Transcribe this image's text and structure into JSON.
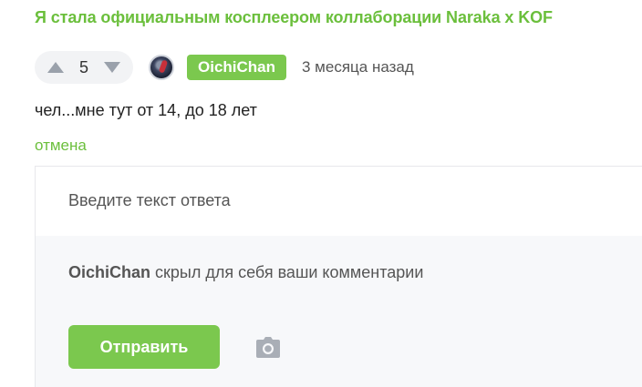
{
  "post": {
    "title": "Я стала официальным косплеером коллаборации Naraka x KOF"
  },
  "comment": {
    "votes": "5",
    "username": "OichiChan",
    "time_ago": "3 месяца назад",
    "text": "чел...мне тут от 14, до 18 лет"
  },
  "reply": {
    "cancel_label": "отмена",
    "placeholder": "Введите текст ответа",
    "hidden_user": "OichiChan",
    "hidden_message": " скрыл для себя ваши комментарии",
    "send_label": "Отправить"
  },
  "colors": {
    "accent": "#7bc84e",
    "title": "#6bbf3c",
    "arrow": "#9aa1ab"
  },
  "icons": [
    "upvote-arrow-icon",
    "downvote-arrow-icon",
    "camera-icon"
  ]
}
